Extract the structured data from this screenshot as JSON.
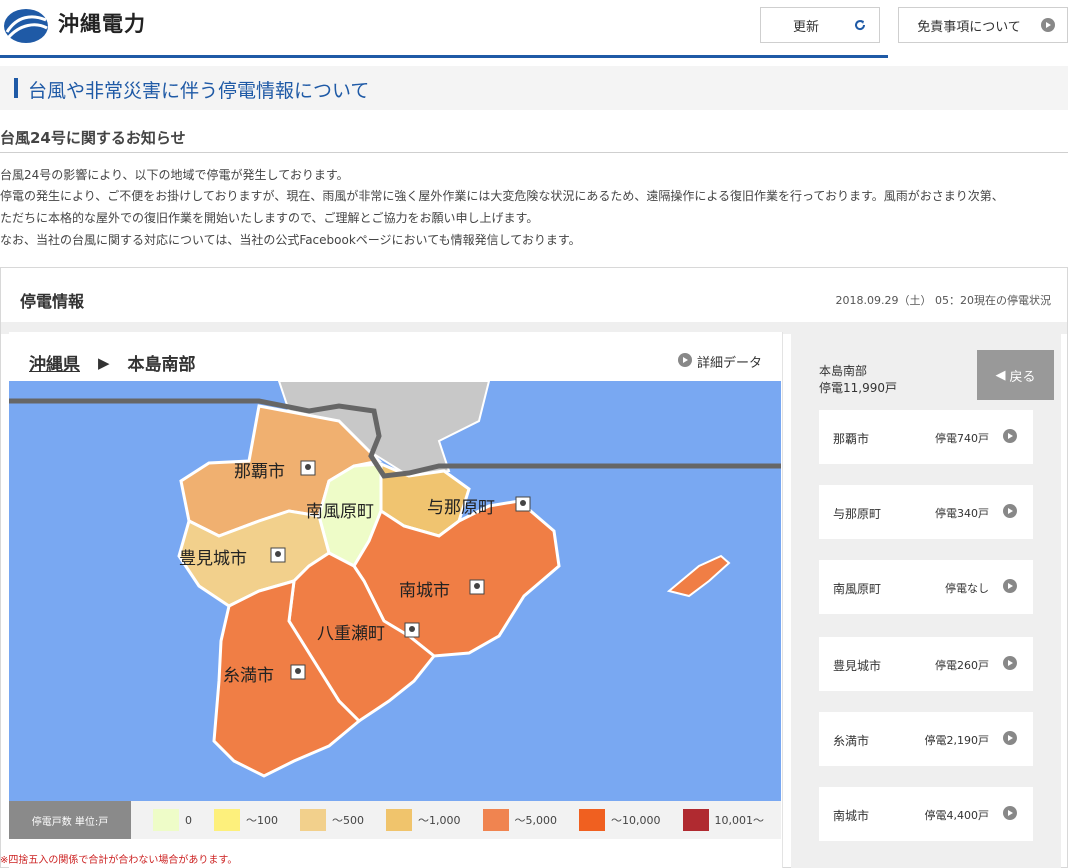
{
  "header": {
    "company_name": "沖縄電力",
    "refresh_label": "更新",
    "disclaimer_label": "免責事項について"
  },
  "page": {
    "title": "台風や非常災害に伴う停電情報について",
    "notice_title": "台風24号に関するお知らせ",
    "paragraphs": [
      "台風24号の影響により、以下の地域で停電が発生しております。",
      "停電の発生により、ご不便をお掛けしておりますが、現在、雨風が非常に強く屋外作業には大変危険な状況にあるため、遠隔操作による復旧作業を行っております。風雨がおさまり次第、",
      "ただちに本格的な屋外での復旧作業を開始いたしますので、ご理解とご協力をお願い申し上げます。",
      "なお、当社の台風に関する対応については、当社の公式Facebookページにおいても情報発信しております。"
    ],
    "footnote": "※四捨五入の関係で合計が合わない場合があります。"
  },
  "panel": {
    "title": "停電情報",
    "timestamp": "2018.09.29（土） 05：20現在の停電状況",
    "breadcrumb": {
      "prefecture": "沖縄県",
      "arrow": "▶",
      "region": "本島南部"
    },
    "detail_label": "詳細データ",
    "map_labels": [
      "那覇市",
      "南風原町",
      "与那原町",
      "豊見城市",
      "南城市",
      "八重瀬町",
      "糸満市"
    ],
    "legend": {
      "title": "停電戸数 単位:戸",
      "items": [
        {
          "label": "0",
          "color": "#eefcc8"
        },
        {
          "label": "～100",
          "color": "#fdf07c"
        },
        {
          "label": "～500",
          "color": "#f2d08c"
        },
        {
          "label": "～1,000",
          "color": "#f0c46c"
        },
        {
          "label": "～5,000",
          "color": "#f08450"
        },
        {
          "label": "～10,000",
          "color": "#f06020"
        },
        {
          "label": "10,001～",
          "color": "#b02a30"
        }
      ]
    },
    "sidebar": {
      "region_name": "本島南部",
      "region_count": "停電11,990戸",
      "back_label": "戻る",
      "rows": [
        {
          "name": "那覇市",
          "count": "停電740戸"
        },
        {
          "name": "与那原町",
          "count": "停電340戸"
        },
        {
          "name": "南風原町",
          "count": "停電なし"
        },
        {
          "name": "豊見城市",
          "count": "停電260戸"
        },
        {
          "name": "糸満市",
          "count": "停電2,190戸"
        },
        {
          "name": "南城市",
          "count": "停電4,400戸"
        }
      ]
    }
  },
  "colors": {
    "brand_blue": "#1f5aa6",
    "sea": "#79a8f2",
    "land_gray": "#c8c8c8",
    "band_500_1000": "#f0b070",
    "band_zero": "#eefcc8",
    "band_1000_5000": "#f07e45"
  },
  "icons": [
    "logo-icon",
    "refresh-icon",
    "arrow-circle-icon",
    "pin-icon",
    "back-arrow-icon"
  ]
}
